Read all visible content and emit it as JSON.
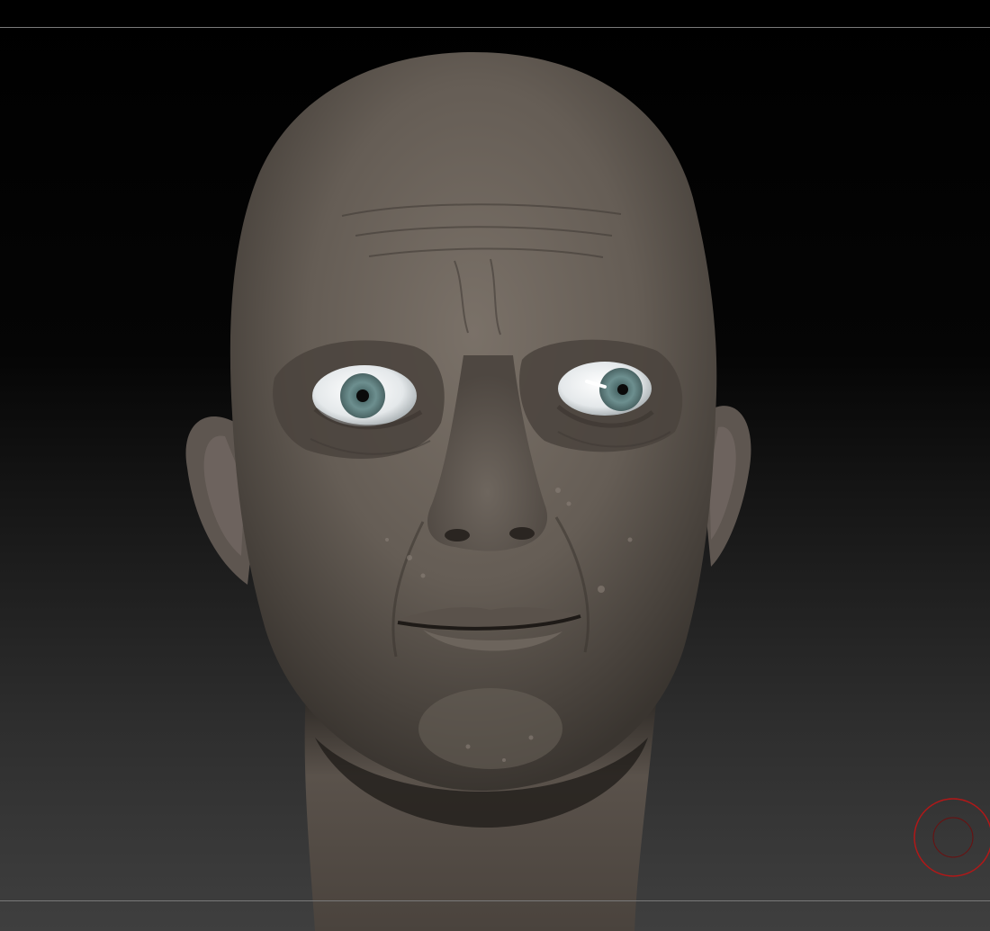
{
  "viewport": {
    "background_top": "#000000",
    "background_bottom": "#404040",
    "rule_color": "#7a7a7a"
  },
  "model": {
    "type": "sculpted-head",
    "skin_color": "#6e655c",
    "iris_color": "#6d8f8f"
  },
  "brush_cursor": {
    "icon": "brush-cursor-icon",
    "color": "#b01818"
  }
}
